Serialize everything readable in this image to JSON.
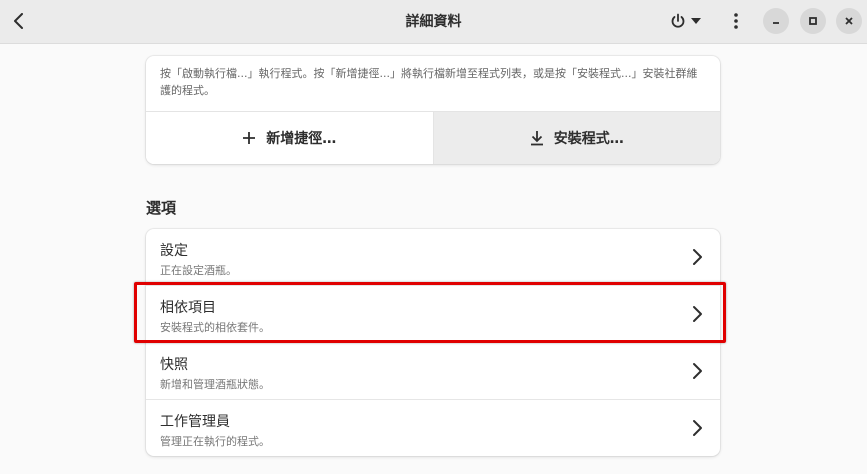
{
  "header": {
    "title": "詳細資料",
    "back_icon": "back-chevron-icon",
    "power_icon": "power-icon",
    "menu_icon": "vertical-ellipsis-icon"
  },
  "top_card": {
    "description": "按「啟動執行檔...」執行程式。按「新增捷徑...」將執行檔新增至程式列表，或是按「安裝程式...」安裝社群維護的程式。",
    "add_shortcut_label": "新增捷徑…",
    "install_program_label": "安裝程式…"
  },
  "options": {
    "section_title": "選項",
    "rows": [
      {
        "title": "設定",
        "subtitle": "正在設定酒瓶。"
      },
      {
        "title": "相依項目",
        "subtitle": "安裝程式的相依套件。"
      },
      {
        "title": "快照",
        "subtitle": "新增和管理酒瓶狀態。"
      },
      {
        "title": "工作管理員",
        "subtitle": "管理正在執行的程式。"
      }
    ]
  },
  "colors": {
    "highlight": "#e00000",
    "headerbar": "#ebebeb",
    "background": "#fafafa"
  }
}
